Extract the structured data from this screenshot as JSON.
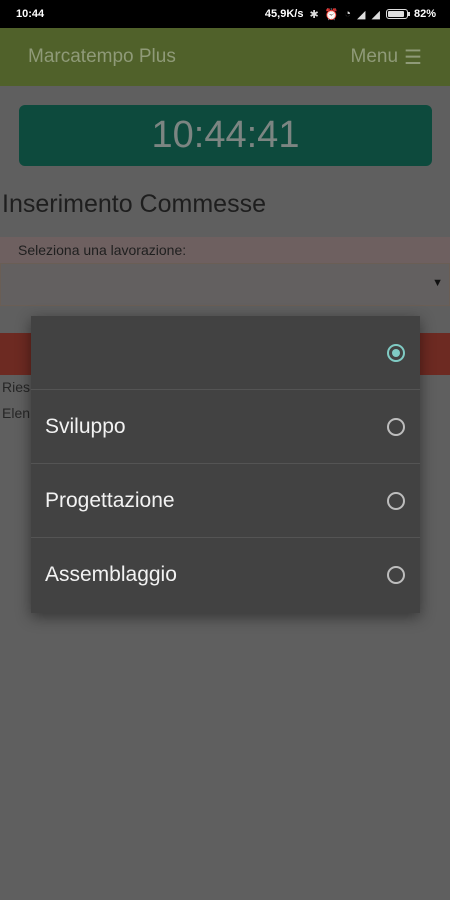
{
  "status_bar": {
    "time": "10:44",
    "network_speed": "45,9K/s",
    "battery": "82%"
  },
  "appbar": {
    "title": "Marcatempo Plus",
    "menu_label": "Menu"
  },
  "page": {
    "clock": "10:44:41",
    "title": "Inserimento Commesse",
    "select_label": "Seleziona una lavorazione:",
    "line1": "Ries",
    "line2": "Elen"
  },
  "dialog": {
    "options": [
      {
        "label": "",
        "checked": true
      },
      {
        "label": "Sviluppo",
        "checked": false
      },
      {
        "label": "Progettazione",
        "checked": false
      },
      {
        "label": "Assemblaggio",
        "checked": false
      }
    ]
  },
  "colors": {
    "accent": "#80cbc4",
    "header": "#50612a",
    "clock_bg": "#0d4a3d"
  }
}
